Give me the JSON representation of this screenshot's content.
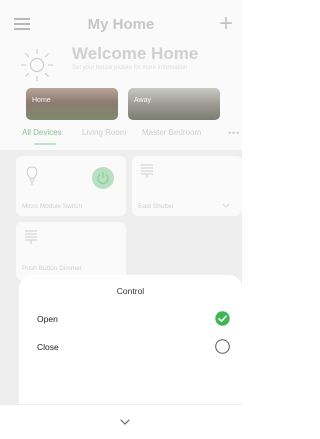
{
  "header": {
    "title": "My Home",
    "welcome": "Welcome Home",
    "welcome_sub": "Set your house picture for more information"
  },
  "homes": [
    {
      "label": "Home"
    },
    {
      "label": "Away"
    }
  ],
  "tabs": [
    {
      "label": "All Devices",
      "active": true
    },
    {
      "label": "Living Room",
      "active": false
    },
    {
      "label": "Master Bedroom",
      "active": false
    }
  ],
  "more_label": "•••",
  "devices": [
    {
      "name": "Micro Module Switch",
      "icon": "bulb-icon",
      "state": "on"
    },
    {
      "name": "East Shutter",
      "icon": "shutter-icon"
    },
    {
      "name": "Push Button Dimmer",
      "icon": "shutter-icon"
    }
  ],
  "sheet": {
    "title": "Control",
    "options": [
      {
        "label": "Open",
        "selected": true
      },
      {
        "label": "Close",
        "selected": false
      }
    ]
  },
  "colors": {
    "accent": "#3fb553",
    "accent_faded": "#b8e0c1"
  }
}
